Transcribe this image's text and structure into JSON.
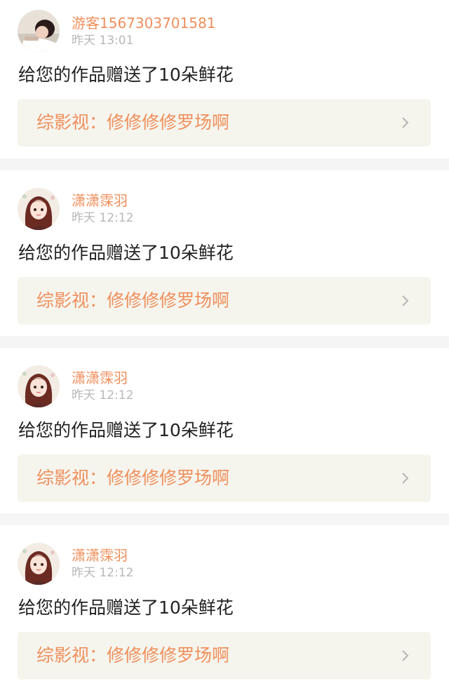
{
  "feed": {
    "items": [
      {
        "username": "游客1567303701581",
        "time": "昨天 13:01",
        "message": "给您的作品赠送了10朵鲜花",
        "work_title": "综影视：修修修修罗场啊",
        "avatar_icon": "user-photo-avatar"
      },
      {
        "username": "潇潇霂羽",
        "time": "昨天 12:12",
        "message": "给您的作品赠送了10朵鲜花",
        "work_title": "综影视：修修修修罗场啊",
        "avatar_icon": "anime-girl-avatar"
      },
      {
        "username": "潇潇霂羽",
        "time": "昨天 12:12",
        "message": "给您的作品赠送了10朵鲜花",
        "work_title": "综影视：修修修修罗场啊",
        "avatar_icon": "anime-girl-avatar"
      },
      {
        "username": "潇潇霂羽",
        "time": "昨天 12:12",
        "message": "给您的作品赠送了10朵鲜花",
        "work_title": "综影视：修修修修罗场啊",
        "avatar_icon": "anime-girl-avatar"
      }
    ]
  },
  "colors": {
    "accent": "#ef8f5c",
    "tab_indicator": "#e8669a",
    "link_background": "#f5f5ee",
    "separator": "#f5f5f5"
  }
}
